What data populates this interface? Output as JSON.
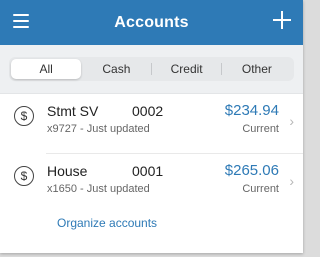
{
  "header": {
    "title": "Accounts",
    "menu_icon": "hamburger-menu-icon",
    "add_icon": "plus-icon",
    "background": "#2e7ab6"
  },
  "tabs": [
    {
      "label": "All",
      "active": true
    },
    {
      "label": "Cash",
      "active": false
    },
    {
      "label": "Credit",
      "active": false
    },
    {
      "label": "Other",
      "active": false
    }
  ],
  "accounts": [
    {
      "icon": "dollar-circle-icon",
      "name": "Stmt SV",
      "number": "0002",
      "subtext": "x9727 - Just updated",
      "amount": "$234.94",
      "status": "Current"
    },
    {
      "icon": "dollar-circle-icon",
      "name": "House",
      "number": "0001",
      "subtext": "x1650 - Just updated",
      "amount": "$265.06",
      "status": "Current"
    }
  ],
  "footer": {
    "organize_label": "Organize accounts"
  }
}
